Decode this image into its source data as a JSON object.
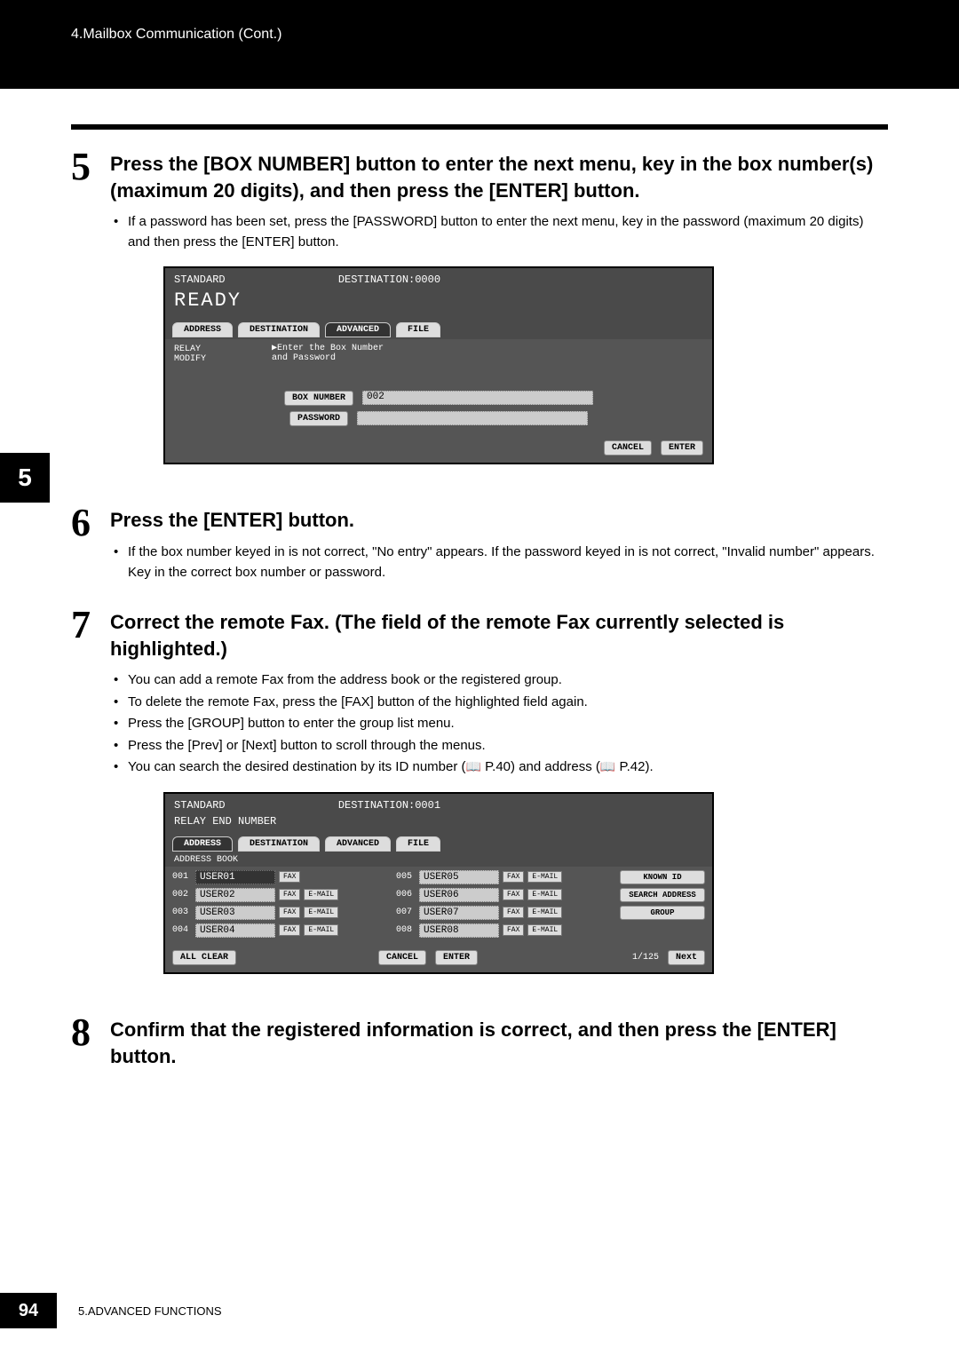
{
  "header": {
    "breadcrumb": "4.Mailbox Communication (Cont.)"
  },
  "side_tab": "5",
  "steps": {
    "s5": {
      "num": "5",
      "heading": "Press the [BOX NUMBER] button to enter the next menu, key in the box number(s) (maximum 20 digits), and then press the [ENTER] button.",
      "bullet1": "If a password has been set, press the [PASSWORD] button to enter the next menu, key in the password (maximum 20 digits) and then press the [ENTER] button."
    },
    "s6": {
      "num": "6",
      "heading": "Press the [ENTER] button.",
      "bullet1": "If the box number keyed in is not correct, \"No entry\" appears. If the password keyed in is not correct, \"Invalid number\" appears. Key in the correct box number or password."
    },
    "s7": {
      "num": "7",
      "heading": "Correct the remote Fax. (The field of the remote Fax currently selected is highlighted.)",
      "b1": "You can add a remote Fax from the address book or the registered group.",
      "b2": "To delete the remote Fax, press the [FAX] button of the highlighted field again.",
      "b3": "Press the [GROUP] button to enter the group list menu.",
      "b4": "Press the [Prev] or [Next] button to scroll through the menus.",
      "b5a": "You can search the desired destination by its ID number (",
      "b5b": " P.40) and address (",
      "b5c": " P.42)."
    },
    "s8": {
      "num": "8",
      "heading": "Confirm that the registered information is correct, and then press the [ENTER] button."
    }
  },
  "lcd1": {
    "standard": "STANDARD",
    "destination": "DESTINATION:0000",
    "ready": "READY",
    "tabs": {
      "address": "ADDRESS",
      "destination_tab": "DESTINATION",
      "advanced": "ADVANCED",
      "file": "FILE"
    },
    "relay_modify_l1": "RELAY",
    "relay_modify_l2": "MODIFY",
    "hint_l1": "▶Enter the Box Number",
    "hint_l2": "and Password",
    "boxnum_btn": "BOX NUMBER",
    "boxnum_val": "002",
    "password_btn": "PASSWORD",
    "cancel": "CANCEL",
    "enter": "ENTER"
  },
  "lcd2": {
    "standard": "STANDARD",
    "destination": "DESTINATION:0001",
    "subtitle": "RELAY END NUMBER",
    "tabs": {
      "address": "ADDRESS",
      "destination_tab": "DESTINATION",
      "advanced": "ADVANCED",
      "file": "FILE"
    },
    "addrbook": "ADDRESS BOOK",
    "rows": {
      "r1": {
        "id": "001",
        "name": "USER01"
      },
      "r2": {
        "id": "002",
        "name": "USER02"
      },
      "r3": {
        "id": "003",
        "name": "USER03"
      },
      "r4": {
        "id": "004",
        "name": "USER04"
      },
      "r5": {
        "id": "005",
        "name": "USER05"
      },
      "r6": {
        "id": "006",
        "name": "USER06"
      },
      "r7": {
        "id": "007",
        "name": "USER07"
      },
      "r8": {
        "id": "008",
        "name": "USER08"
      }
    },
    "fax": "FAX",
    "email": "E-MAIL",
    "known_id": "KNOWN ID",
    "search_address": "SEARCH ADDRESS",
    "group": "GROUP",
    "all_clear": "ALL CLEAR",
    "cancel": "CANCEL",
    "enter": "ENTER",
    "page": "1/125",
    "next": "Next"
  },
  "footer": {
    "page_num": "94",
    "section": "5.ADVANCED FUNCTIONS"
  }
}
